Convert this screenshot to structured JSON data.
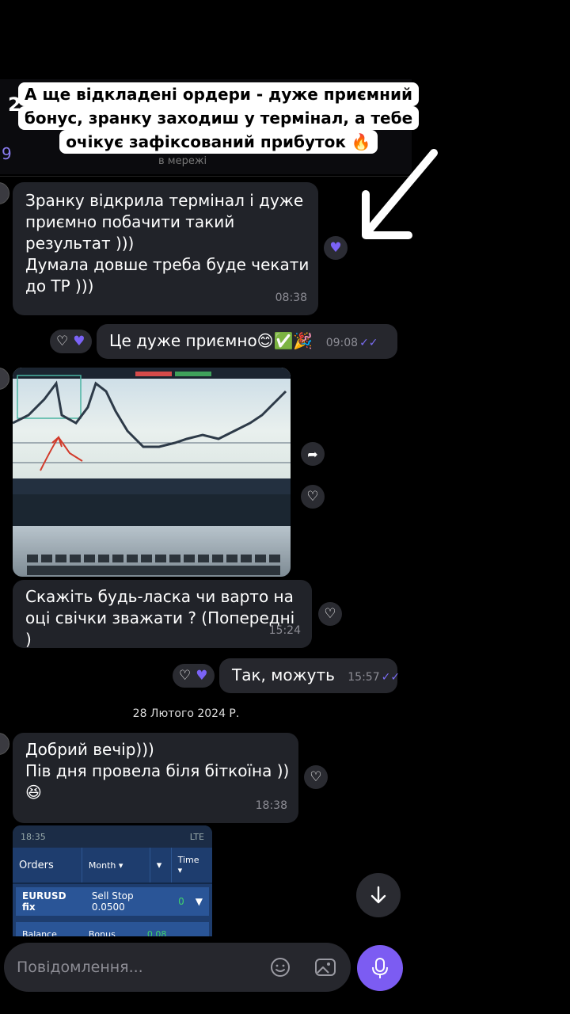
{
  "header": {
    "left_fragment": "2",
    "left_count": "9",
    "status": "в мережі"
  },
  "story_caption": "А ще відкладені ордери - дуже приємний бонус, зранку заходиш у термінал, а тебе очікує зафіксований прибуток 🔥",
  "messages": [
    {
      "text": "Зранку відкрила термінал і дуже приємно побачити такий результат )))\nДумала довше треба буде чекати до ТР )))",
      "time": "08:38"
    },
    {
      "text": "Це дуже приємно😊✅🎉",
      "time": "09:08"
    },
    {
      "text": "Скажіть будь-ласка чи варто на оці свічки зважати ? (Попередні )",
      "time": "15:24"
    },
    {
      "text": "Так, можуть",
      "time": "15:57"
    },
    {
      "text": "Добрий вечір)))\nПів дня провела біля біткоїна ))\n😆",
      "time": "18:38"
    }
  ],
  "date_separator": "28 Лютого 2024 Р.",
  "screenshot_preview": {
    "status_time": "18:35",
    "status_right": "LTE",
    "tab_orders": "Orders",
    "tab_month": "Month ▾",
    "tab_arrow": "▾",
    "tab_time": "Time ▾",
    "row_symbol": "EURUSD fix",
    "row_type": "Sell Stop 0.0500",
    "row_value": "0",
    "row2_left": "Balance",
    "row2_mid": "Bonus",
    "row2_right": "0.08"
  },
  "input": {
    "placeholder": "Повідомлення..."
  },
  "colors": {
    "accent": "#7c5cf2",
    "bubble": "#212329",
    "background": "#000000",
    "ticks": "#7b6df5"
  }
}
